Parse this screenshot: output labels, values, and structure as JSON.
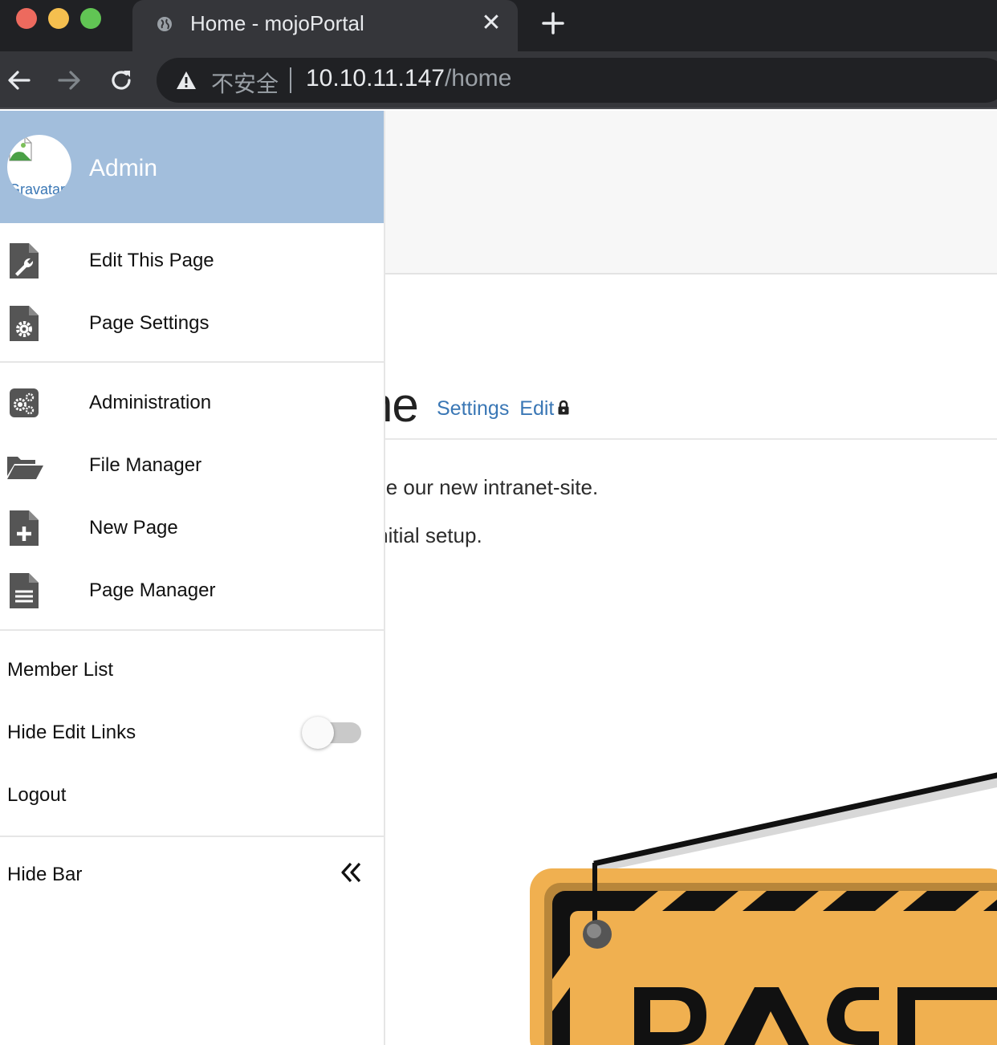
{
  "browser": {
    "tab_title": "Home - mojoPortal",
    "security_label": "不安全",
    "url_host": "10.10.11.147",
    "url_path": "/home"
  },
  "page": {
    "title_fragment": "ne",
    "settings_link": "Settings",
    "edit_link": "Edit",
    "body_line1": "ally be our new intranet-site.",
    "body_line2": "the initial setup."
  },
  "panel": {
    "user_name": "Admin",
    "avatar_alt": "Gravatar",
    "groups": [
      [
        {
          "label": "Edit This Page",
          "icon": "file-wrench-icon"
        },
        {
          "label": "Page Settings",
          "icon": "file-gear-icon"
        }
      ],
      [
        {
          "label": "Administration",
          "icon": "gears-icon"
        },
        {
          "label": "File Manager",
          "icon": "folder-open-icon"
        },
        {
          "label": "New Page",
          "icon": "file-plus-icon"
        },
        {
          "label": "Page Manager",
          "icon": "file-lines-icon"
        }
      ]
    ],
    "member_list": "Member List",
    "hide_edit_links": "Hide Edit Links",
    "hide_edit_links_on": false,
    "logout": "Logout",
    "hide_bar": "Hide Bar"
  },
  "colors": {
    "panel_header": "#a2bedc",
    "link": "#3a77b5",
    "chrome_dark": "#202124",
    "chrome_tab": "#35363a",
    "sign_orange": "#f0b050"
  }
}
